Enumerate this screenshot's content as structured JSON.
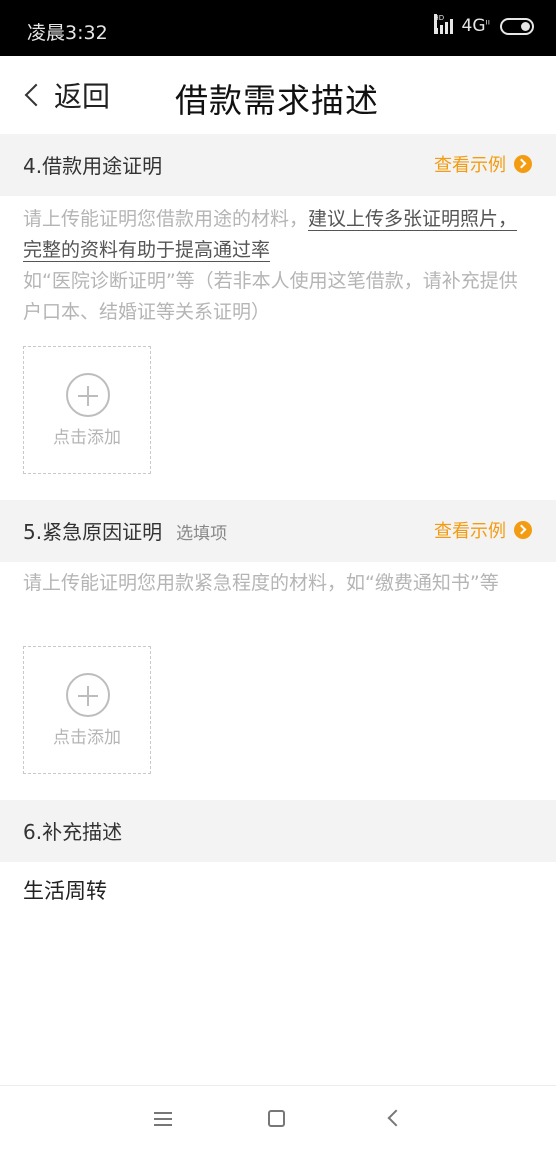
{
  "status_bar": {
    "time": "凌晨3:32",
    "hd_label": "HD",
    "network": "4G",
    "network_sup": "ıı"
  },
  "nav": {
    "back_label": "返回",
    "title": "借款需求描述"
  },
  "sections": [
    {
      "title": "4.借款用途证明",
      "example_label": "查看示例",
      "description_plain": "请上传能证明您借款用途的材料，",
      "description_emphasis": "建议上传多张证明照片，完整的资料有助于提高通过率",
      "description_note": "如“医院诊断证明”等（若非本人使用这笔借款，请补充提供户口本、结婚证等关系证明）",
      "add_label": "点击添加"
    },
    {
      "title": "5.紧急原因证明",
      "optional_tag": "选填项",
      "example_label": "查看示例",
      "description_plain": "请上传能证明您用款紧急程度的材料，如“缴费通知书”等",
      "add_label": "点击添加"
    },
    {
      "title": "6.补充描述",
      "content": "生活周转"
    }
  ],
  "colors": {
    "accent": "#f39c12",
    "section_bg": "#f3f3f3",
    "hint_text": "#b5b5b5"
  },
  "icons": {
    "back": "chevron-left-icon",
    "example": "circle-chevron-right-icon",
    "add": "plus-circle-icon",
    "sys_menu": "menu-icon",
    "sys_home": "square-home-icon",
    "sys_back": "triangle-back-icon"
  }
}
